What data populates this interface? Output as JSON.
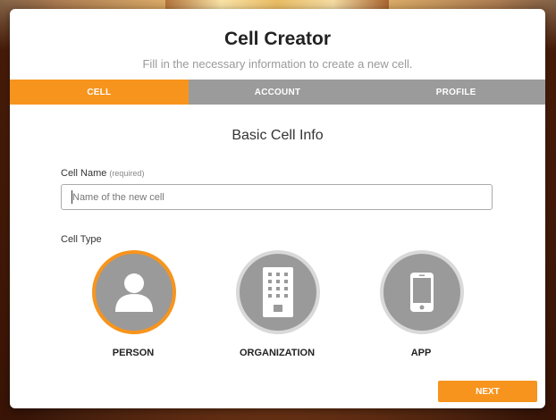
{
  "dialog": {
    "title": "Cell Creator",
    "subtitle": "Fill in the necessary information to create a new cell."
  },
  "tabs": [
    {
      "label": "CELL",
      "active": true
    },
    {
      "label": "ACCOUNT",
      "active": false
    },
    {
      "label": "PROFILE",
      "active": false
    }
  ],
  "section": {
    "title": "Basic Cell Info"
  },
  "cell_name": {
    "label": "Cell Name",
    "required_note": "(required)",
    "value": "",
    "placeholder": "Name of the new cell"
  },
  "cell_type": {
    "label": "Cell Type",
    "selected": "PERSON",
    "options": [
      {
        "label": "PERSON",
        "icon": "person-icon"
      },
      {
        "label": "ORGANIZATION",
        "icon": "building-icon"
      },
      {
        "label": "APP",
        "icon": "smartphone-icon"
      }
    ]
  },
  "actions": {
    "next_label": "NEXT"
  },
  "colors": {
    "accent": "#f7941d",
    "tab_bar": "#9b9b9b",
    "icon_circle": "#9a9a9a",
    "icon_ring": "#d9d9d9"
  }
}
